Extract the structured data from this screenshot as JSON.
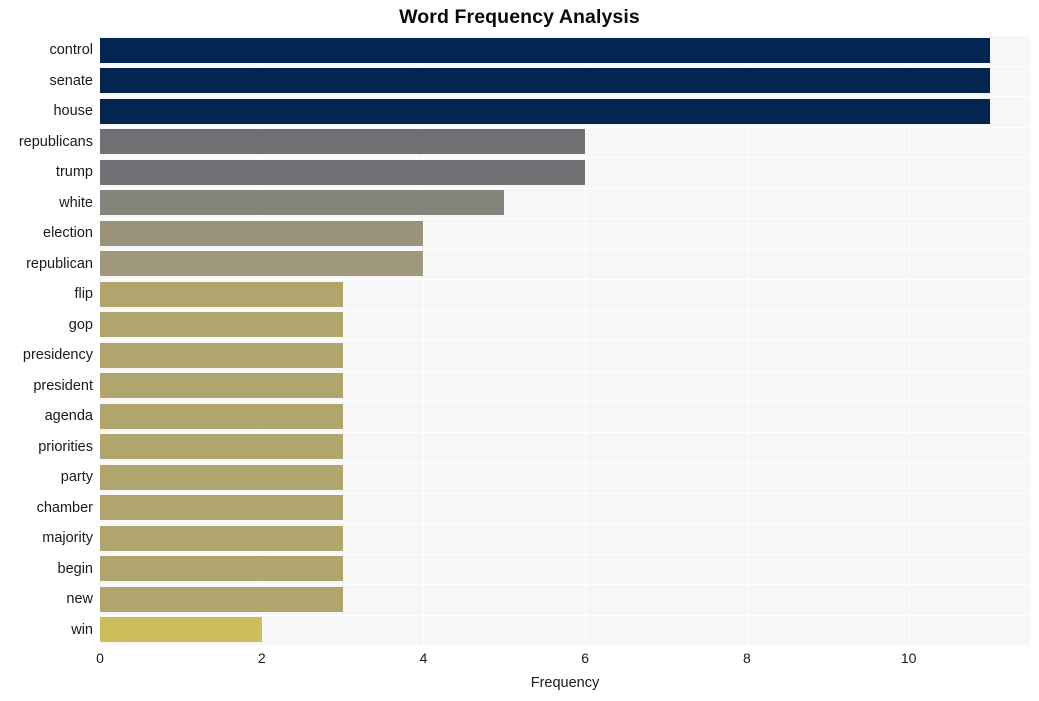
{
  "chart_data": {
    "type": "bar",
    "orientation": "horizontal",
    "title": "Word Frequency Analysis",
    "xlabel": "Frequency",
    "ylabel": "",
    "xlim": [
      0,
      11.5
    ],
    "xticks": [
      0,
      2,
      4,
      6,
      8,
      10
    ],
    "grid": true,
    "legend": false,
    "categories": [
      "control",
      "senate",
      "house",
      "republicans",
      "trump",
      "white",
      "election",
      "republican",
      "flip",
      "gop",
      "presidency",
      "president",
      "agenda",
      "priorities",
      "party",
      "chamber",
      "majority",
      "begin",
      "new",
      "win"
    ],
    "values": [
      11,
      11,
      11,
      6,
      6,
      5,
      4,
      4,
      3,
      3,
      3,
      3,
      3,
      3,
      3,
      3,
      3,
      3,
      3,
      2
    ],
    "bar_colors": [
      "#042452",
      "#04254f",
      "#03254f",
      "#6e7073",
      "#717276",
      "#84847b",
      "#9a9379",
      "#9f987c",
      "#b0a56d",
      "#b0a56d",
      "#b0a56d",
      "#b0a56d",
      "#b0a56d",
      "#b0a56d",
      "#b0a56d",
      "#b0a56d",
      "#b0a56d",
      "#b0a56d",
      "#b0a56d",
      "#cdbe5c"
    ],
    "plot_background": "#f7f7f7",
    "gridline_color": "#ffffff",
    "figure_background": "#ffffff"
  }
}
